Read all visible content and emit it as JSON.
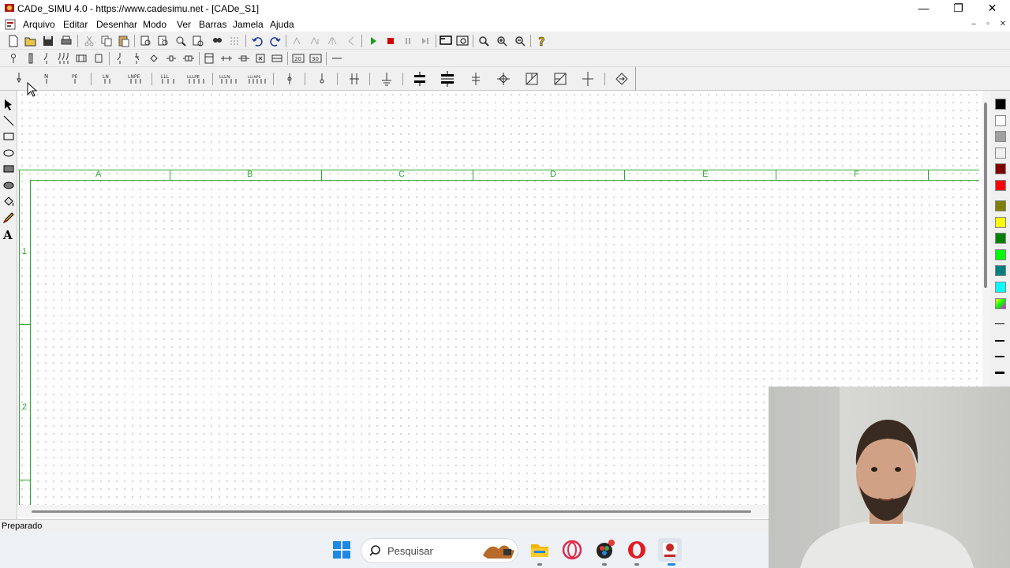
{
  "window": {
    "title": "CADe_SIMU 4.0 - https://www.cadesimu.net - [CADe_S1]",
    "controls": [
      "—",
      "❐",
      "✕"
    ],
    "mdi_controls": [
      "–",
      "▫",
      "✕"
    ]
  },
  "menu": {
    "items": [
      "Arquivo",
      "Editar",
      "Desenhar",
      "Modo",
      "Ver",
      "Barras",
      "Jamela",
      "Ajuda"
    ]
  },
  "toolbar1": {
    "icons": [
      "new-file-icon",
      "open-folder-icon",
      "save-icon",
      "print-icon",
      "cut-icon",
      "copy-icon",
      "paste-icon",
      "print-preview-icon",
      "zoom-window-icon",
      "zoom-page-icon",
      "zoom-print-icon",
      "find-icon",
      "grid-icon",
      "undo-icon",
      "redo-icon",
      "rotate-icon",
      "mirror-icon",
      "flip-icon",
      "arrow-left-icon",
      "play-icon",
      "stop-icon",
      "pause-icon",
      "step-icon",
      "window-select-icon",
      "window-zoom-icon",
      "zoom-in-icon",
      "zoom-fit-icon",
      "zoom-out-icon",
      "help-icon"
    ],
    "colors": {
      "play": "#1a9e1a",
      "stop": "#d10000",
      "help": "#c8a000"
    }
  },
  "toolbar2": {
    "icons": [
      "pin-icon",
      "fuse-icon",
      "breaker-icon",
      "triple-breaker-icon",
      "thermal-icon",
      "battery-icon",
      "contact-no-icon",
      "contact-nc-icon",
      "diamond-icon",
      "coil-icon",
      "coil-double-icon",
      "timer-icon",
      "terminal-icon",
      "bridge-icon",
      "tab-icon",
      "box-20-icon",
      "box-30-icon",
      "line-icon"
    ]
  },
  "toolbar3": {
    "icons": [
      "terminal-1p-icon",
      "terminal-n-icon",
      "terminal-pe-icon",
      "terminal-ln-icon",
      "terminal-lnpe-icon",
      "terminal-3l-icon",
      "terminal-3lpe-icon",
      "terminal-3ln-icon",
      "terminal-3lnpe-icon",
      "terminal-down-icon",
      "terminal-circle-icon",
      "terminal-multi-icon",
      "ground-icon",
      "bus-double-icon",
      "bus-triple-icon",
      "junction-icon",
      "cross-connector-icon",
      "angle-icon",
      "angle-box-icon",
      "crossing-icon",
      "rotate-connector-icon"
    ]
  },
  "left_tools": [
    "select-arrow-icon",
    "draw-line-icon",
    "rectangle-icon",
    "ellipse-icon",
    "filled-rectangle-icon",
    "filled-ellipse-icon",
    "fill-bucket-icon",
    "color-pencil-icon",
    "text-tool-icon"
  ],
  "sheet": {
    "columns": [
      "A",
      "B",
      "C",
      "D",
      "E",
      "F"
    ],
    "rows": [
      "1",
      "2"
    ],
    "frame_color": "#2ea82e"
  },
  "palette": {
    "colors": [
      "#000000",
      "#ffffff",
      "#a0a0a0",
      "#f0f0f0",
      "#800000",
      "#ff0000",
      "#808000",
      "#ffff00",
      "#008000",
      "#00ff00",
      "#008080",
      "#00ffff",
      "#c0c000"
    ],
    "line_widths": [
      1,
      2,
      3,
      4
    ]
  },
  "status": {
    "text": "Preparado"
  },
  "taskbar": {
    "search_placeholder": "Pesquisar",
    "apps": [
      "windows-start-icon",
      "search-icon",
      "camera-app-icon",
      "file-explorer-icon",
      "opera-gx-icon",
      "davinci-icon",
      "opera-icon",
      "cadesimu-taskbar-icon"
    ]
  }
}
